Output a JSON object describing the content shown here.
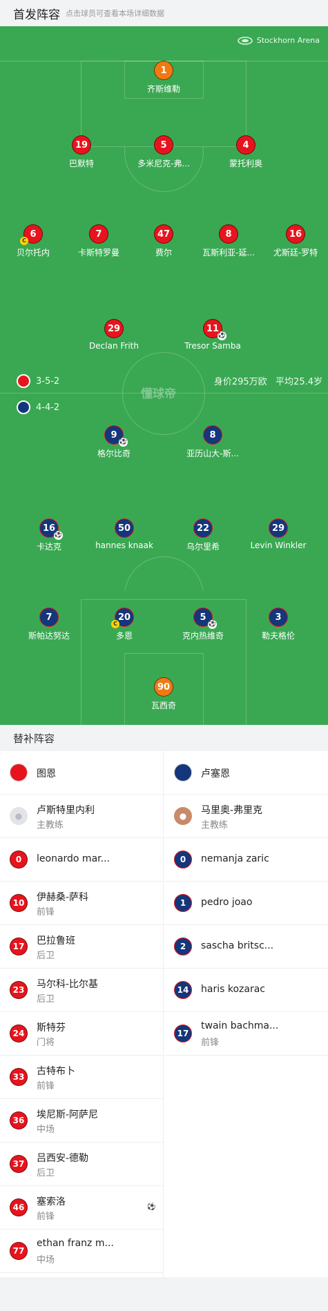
{
  "header": {
    "title": "首发阵容",
    "subtitle": "点击球员可查看本场详细数据"
  },
  "pitch": {
    "venue": "Stockhorn Arena",
    "watermark": "懂球帝",
    "home_formation": "3-5-2",
    "away_formation": "4-4-2",
    "home_value": "身价295万欧",
    "home_avg_age": "平均25.4岁"
  },
  "players_home": [
    {
      "num": "1",
      "name": "齐斯维勒"
    },
    {
      "num": "19",
      "name": "巴默特"
    },
    {
      "num": "5",
      "name": "多米尼克-弗..."
    },
    {
      "num": "4",
      "name": "蒙托利奥"
    },
    {
      "num": "6",
      "name": "贝尔托内"
    },
    {
      "num": "7",
      "name": "卡斯特罗曼"
    },
    {
      "num": "47",
      "name": "费尔"
    },
    {
      "num": "8",
      "name": "瓦斯利亚-延..."
    },
    {
      "num": "16",
      "name": "尤斯廷-罗特"
    },
    {
      "num": "29",
      "name": "Declan Frith"
    },
    {
      "num": "11",
      "name": "Tresor Samba"
    }
  ],
  "players_away": [
    {
      "num": "9",
      "name": "格尔比奇"
    },
    {
      "num": "8",
      "name": "亚历山大-斯..."
    },
    {
      "num": "16",
      "name": "卡达克"
    },
    {
      "num": "50",
      "name": "hannes knaak"
    },
    {
      "num": "22",
      "name": "乌尔里希"
    },
    {
      "num": "29",
      "name": "Levin Winkler"
    },
    {
      "num": "7",
      "name": "斯帕达努达"
    },
    {
      "num": "20",
      "name": "多恩"
    },
    {
      "num": "5",
      "name": "克内热维奇"
    },
    {
      "num": "3",
      "name": "勒夫格伦"
    },
    {
      "num": "90",
      "name": "瓦西奇"
    }
  ],
  "subs_title": "替补阵容",
  "home_team": {
    "name": "图恩",
    "coach": "卢斯特里内利",
    "coach_role": "主教练",
    "color": "#e8141d"
  },
  "away_team": {
    "name": "卢塞恩",
    "coach": "马里奥-弗里克",
    "coach_role": "主教练",
    "color": "#14367a"
  },
  "subs_home": [
    {
      "num": "0",
      "name": "leonardo mar...",
      "pos": ""
    },
    {
      "num": "10",
      "name": "伊赫桑-萨科",
      "pos": "前锋"
    },
    {
      "num": "17",
      "name": "巴拉鲁班",
      "pos": "后卫"
    },
    {
      "num": "23",
      "name": "马尔科-比尔基",
      "pos": "后卫"
    },
    {
      "num": "24",
      "name": "斯特芬",
      "pos": "门将"
    },
    {
      "num": "33",
      "name": "古特布卜",
      "pos": "前锋"
    },
    {
      "num": "36",
      "name": "埃尼斯-阿萨尼",
      "pos": "中场"
    },
    {
      "num": "37",
      "name": "吕西安-德勒",
      "pos": "后卫"
    },
    {
      "num": "46",
      "name": "塞索洛",
      "pos": "前锋"
    },
    {
      "num": "77",
      "name": "ethan franz m...",
      "pos": "中场"
    }
  ],
  "subs_away": [
    {
      "num": "0",
      "name": "nemanja zaric",
      "pos": ""
    },
    {
      "num": "1",
      "name": "pedro joao",
      "pos": ""
    },
    {
      "num": "2",
      "name": "sascha britsc...",
      "pos": ""
    },
    {
      "num": "14",
      "name": "haris kozarac",
      "pos": ""
    },
    {
      "num": "17",
      "name": "twain bachma...",
      "pos": "前锋"
    }
  ]
}
